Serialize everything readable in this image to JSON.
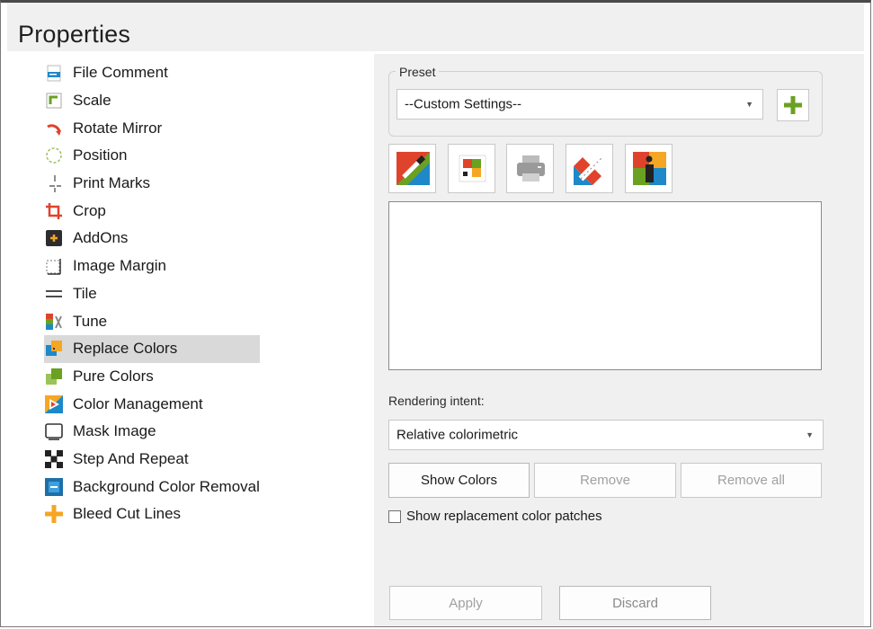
{
  "window": {
    "title": "Properties"
  },
  "tree": {
    "items": [
      {
        "label": "File Comment",
        "icon": "file-comment-icon"
      },
      {
        "label": "Scale",
        "icon": "scale-icon"
      },
      {
        "label": "Rotate Mirror",
        "icon": "rotate-mirror-icon"
      },
      {
        "label": "Position",
        "icon": "position-icon"
      },
      {
        "label": "Print Marks",
        "icon": "print-marks-icon"
      },
      {
        "label": "Crop",
        "icon": "crop-icon"
      },
      {
        "label": "AddOns",
        "icon": "addons-icon"
      },
      {
        "label": "Image Margin",
        "icon": "image-margin-icon"
      },
      {
        "label": "Tile",
        "icon": "tile-icon"
      },
      {
        "label": "Tune",
        "icon": "tune-icon"
      },
      {
        "label": "Replace Colors",
        "icon": "replace-colors-icon",
        "selected": true
      },
      {
        "label": "Pure Colors",
        "icon": "pure-colors-icon"
      },
      {
        "label": "Color Management",
        "icon": "color-management-icon"
      },
      {
        "label": "Mask Image",
        "icon": "mask-image-icon"
      },
      {
        "label": "Step And Repeat",
        "icon": "step-and-repeat-icon"
      },
      {
        "label": "Background Color Removal",
        "icon": "background-color-removal-icon"
      },
      {
        "label": "Bleed Cut Lines",
        "icon": "bleed-cut-lines-icon"
      }
    ]
  },
  "preset": {
    "legend": "Preset",
    "value": "--Custom Settings--"
  },
  "rendering": {
    "label": "Rendering intent:",
    "value": "Relative colorimetric"
  },
  "buttons": {
    "show_colors": "Show Colors",
    "remove": "Remove",
    "remove_all": "Remove all",
    "apply": "Apply",
    "discard": "Discard"
  },
  "checkbox": {
    "label": "Show replacement color patches",
    "checked": false
  },
  "colors": {
    "selected_bg": "#d9d9d9",
    "pane_bg": "#f0f0f0",
    "accent_green": "#6aa121"
  }
}
